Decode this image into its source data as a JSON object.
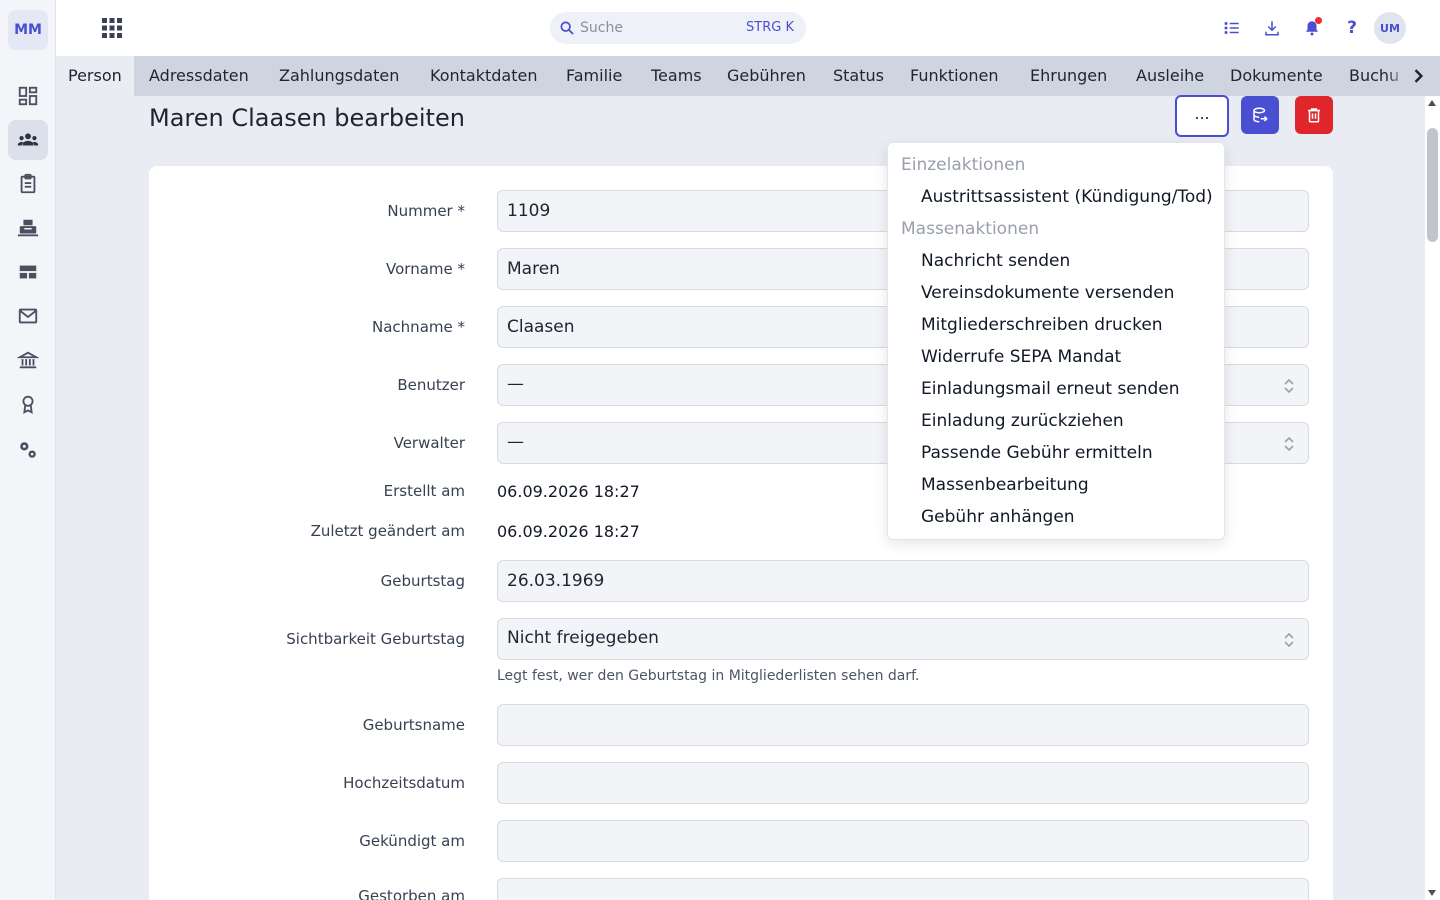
{
  "sidebar": {
    "logo": "MM",
    "items": [
      {
        "icon": "dashboard-icon",
        "active": false
      },
      {
        "icon": "members-icon",
        "active": true
      },
      {
        "icon": "clipboard-icon",
        "active": false
      },
      {
        "icon": "printer-icon",
        "active": false
      },
      {
        "icon": "table-icon",
        "active": false
      },
      {
        "icon": "mail-icon",
        "active": false
      },
      {
        "icon": "bank-icon",
        "active": false
      },
      {
        "icon": "award-icon",
        "active": false
      },
      {
        "icon": "settings-icon",
        "active": false
      }
    ]
  },
  "topbar": {
    "search_placeholder": "Suche",
    "search_shortcut": "STRG K",
    "help_label": "?",
    "avatar": "UM"
  },
  "tabs": [
    "Person",
    "Adressdaten",
    "Zahlungsdaten",
    "Kontaktdaten",
    "Familie",
    "Teams",
    "Gebühren",
    "Status",
    "Funktionen",
    "Ehrungen",
    "Ausleihe",
    "Dokumente",
    "Buchu"
  ],
  "header": {
    "title": "Maren Claasen bearbeiten",
    "more_label": "..."
  },
  "form": {
    "nummer_label": "Nummer *",
    "nummer_value": "1109",
    "vorname_label": "Vorname *",
    "vorname_value": "Maren",
    "nachname_label": "Nachname *",
    "nachname_value": "Claasen",
    "benutzer_label": "Benutzer",
    "benutzer_value": "—",
    "verwalter_label": "Verwalter",
    "verwalter_value": "—",
    "erstellt_label": "Erstellt am",
    "erstellt_value": "06.09.2026 18:27",
    "geaendert_label": "Zuletzt geändert am",
    "geaendert_value": "06.09.2026 18:27",
    "geburtstag_label": "Geburtstag",
    "geburtstag_value": "26.03.1969",
    "sichtbarkeit_label": "Sichtbarkeit Geburtstag",
    "sichtbarkeit_value": "Nicht freigegeben",
    "sichtbarkeit_help": "Legt fest, wer den Geburtstag in Mitgliederlisten sehen darf.",
    "geburtsname_label": "Geburtsname",
    "hochzeitsdatum_label": "Hochzeitsdatum",
    "gekuendigt_label": "Gekündigt am",
    "gestorben_label": "Gestorben am"
  },
  "menu": {
    "heading_single": "Einzelaktionen",
    "single_items": [
      "Austrittsassistent (Kündigung/Tod)"
    ],
    "heading_mass": "Massenaktionen",
    "mass_items": [
      "Nachricht senden",
      "Vereinsdokumente versenden",
      "Mitgliederschreiben drucken",
      "Widerrufe SEPA Mandat",
      "Einladungsmail erneut senden",
      "Einladung zurückziehen",
      "Passende Gebühr ermitteln",
      "Massenbearbeitung",
      "Gebühr anhängen"
    ]
  },
  "colors": {
    "accent": "#4a4fd1",
    "danger": "#e0252b",
    "notification": "#ef2b2b"
  }
}
